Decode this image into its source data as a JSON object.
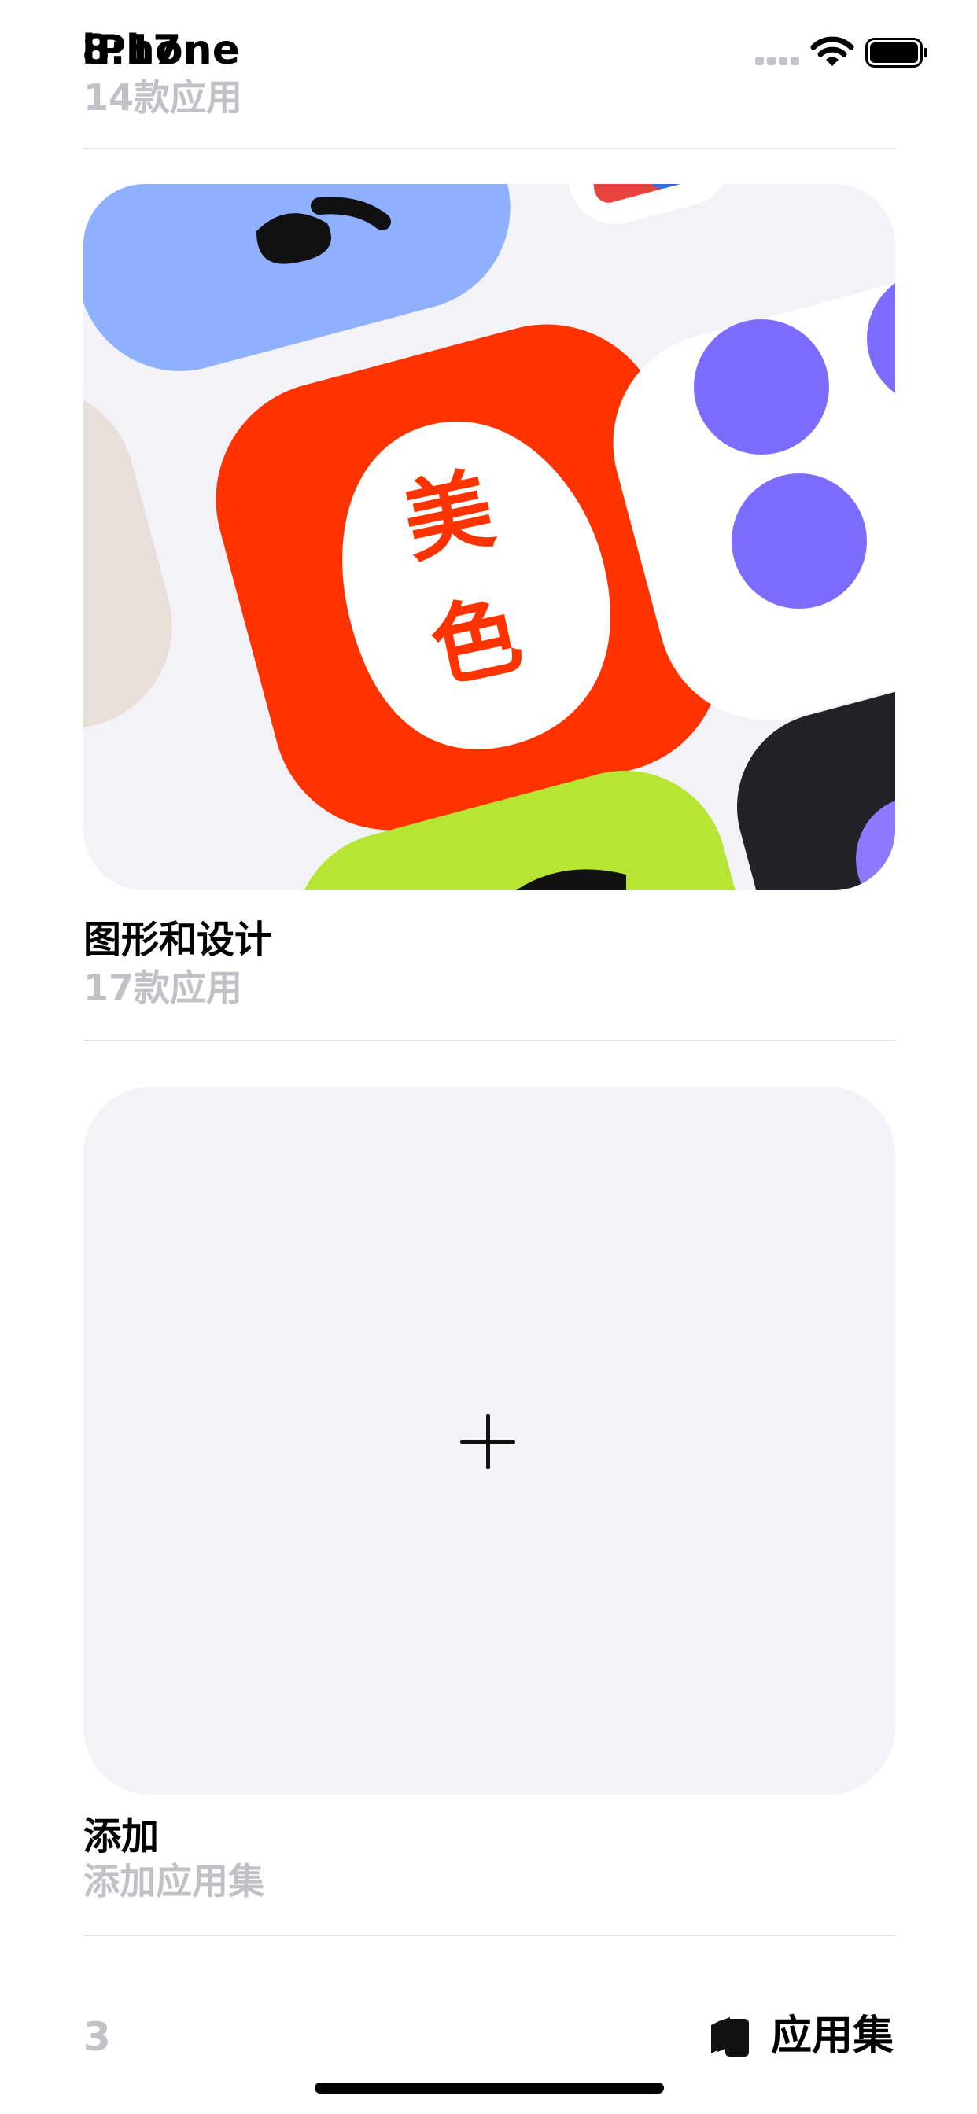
{
  "status_bar": {
    "time": "8:17",
    "carrier": "iPhone"
  },
  "previous_collection": {
    "subtitle": "14款应用"
  },
  "collections": [
    {
      "title": "图形和设计",
      "subtitle": "17款应用",
      "icon_text_1": "美",
      "icon_text_2": "色"
    }
  ],
  "add_collection": {
    "title": "添加",
    "subtitle": "添加应用集"
  },
  "toolbar": {
    "count": "3",
    "collections_label": "应用集"
  },
  "colors": {
    "accent_red": "#ff3300",
    "purple": "#7b6cff",
    "blue": "#8fb0ff",
    "lime": "#b6e534",
    "card_bg": "#f2f2f7",
    "subtitle_gray": "#c2c2c6"
  }
}
